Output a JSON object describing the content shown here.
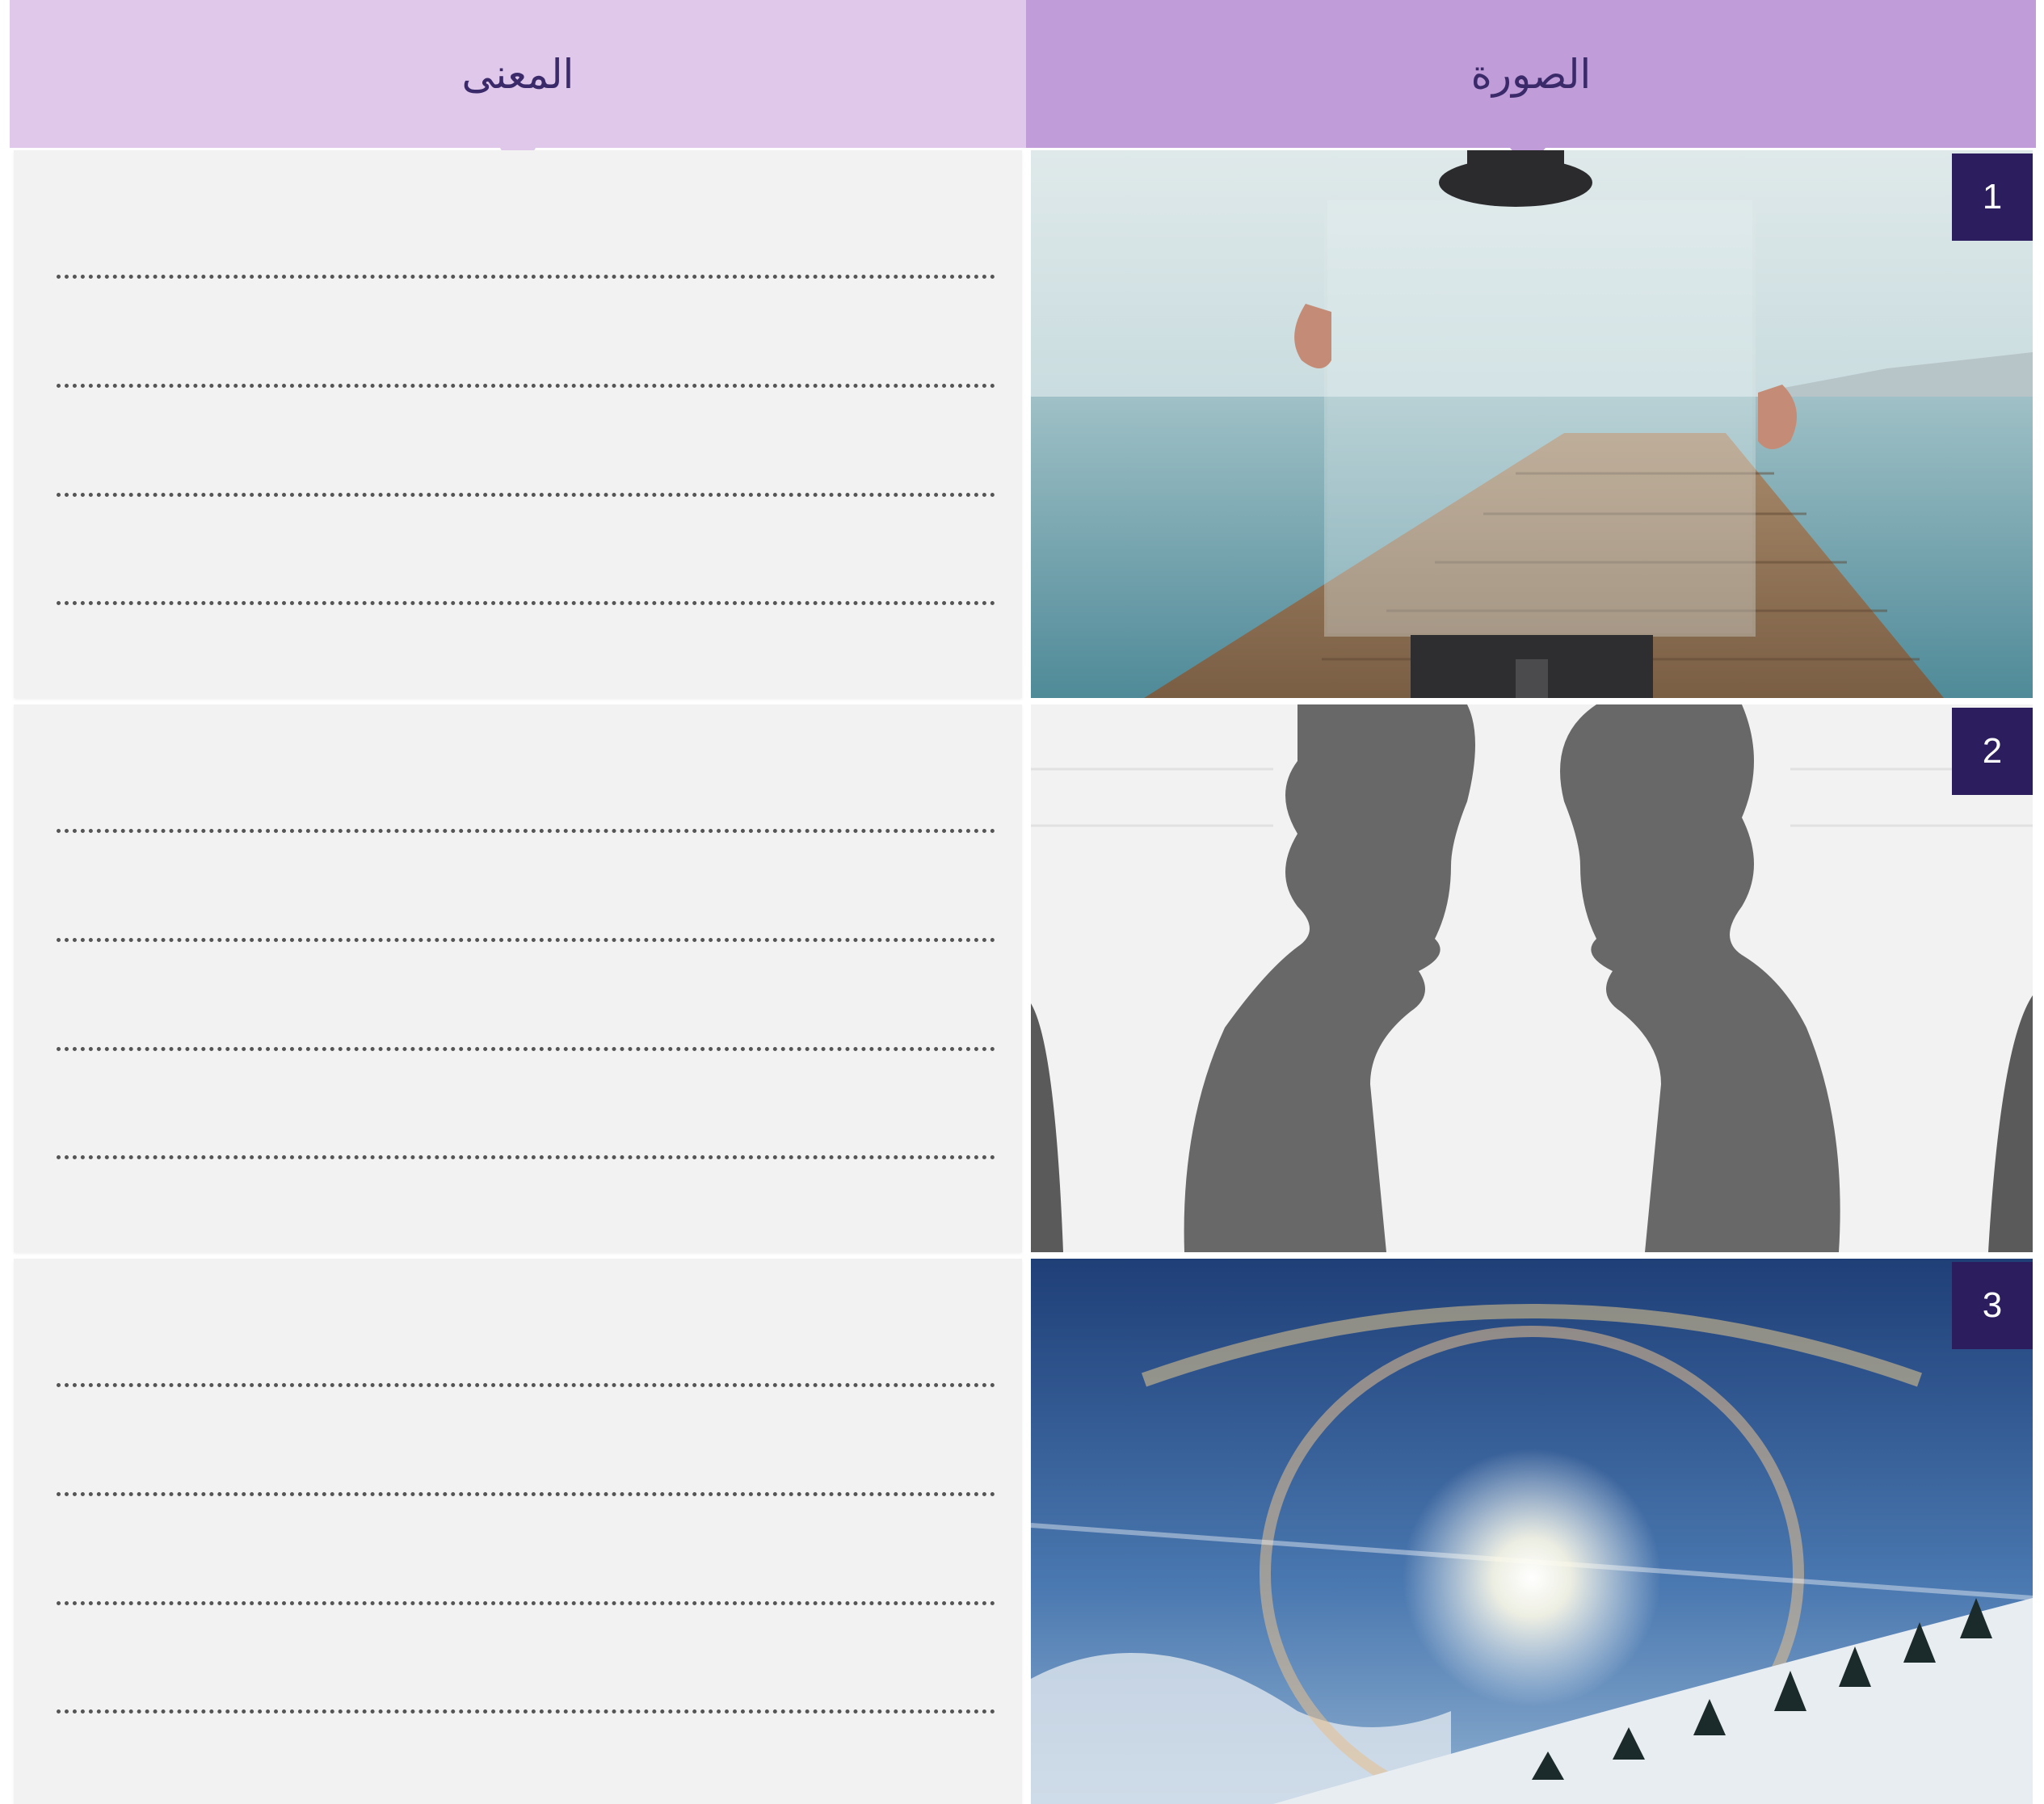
{
  "table": {
    "header_meaning": "المعنى",
    "header_image": "الصورة"
  },
  "rows": [
    {
      "number": "1",
      "image": "man holding glass pane in front of wooden pier over sea"
    },
    {
      "number": "2",
      "image": "face silhouettes and vase optical illusion"
    },
    {
      "number": "3",
      "image": "sun halo in blue sky over snowy hills"
    }
  ],
  "colors": {
    "header_meaning_bg": "#dfc8ea",
    "header_image_bg": "#c09cd8",
    "badge_bg": "#2c1d5e",
    "cell_bg": "#f2f2f2"
  }
}
